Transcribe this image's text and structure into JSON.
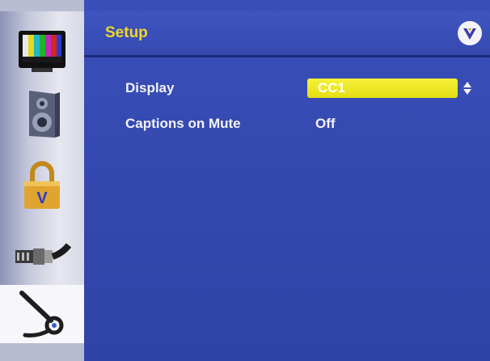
{
  "header": {
    "title": "Setup",
    "logo_icon": "vizio-logo-icon"
  },
  "sidebar": {
    "items": [
      {
        "name": "picture",
        "icon": "tv-color-bars-icon",
        "active": false
      },
      {
        "name": "audio",
        "icon": "speaker-icon",
        "active": false
      },
      {
        "name": "parental",
        "icon": "padlock-icon",
        "active": false
      },
      {
        "name": "input",
        "icon": "cable-connector-icon",
        "active": false
      },
      {
        "name": "setup",
        "icon": "wrench-icon",
        "active": true
      }
    ]
  },
  "menu": {
    "rows": [
      {
        "label": "Display",
        "value": "CC1",
        "selected": true
      },
      {
        "label": "Captions on Mute",
        "value": "Off",
        "selected": false
      }
    ]
  },
  "colors": {
    "background": "#3347ad",
    "title": "#f0d62a",
    "highlight": "#f2ec2a",
    "text": "#f3f3f7"
  }
}
